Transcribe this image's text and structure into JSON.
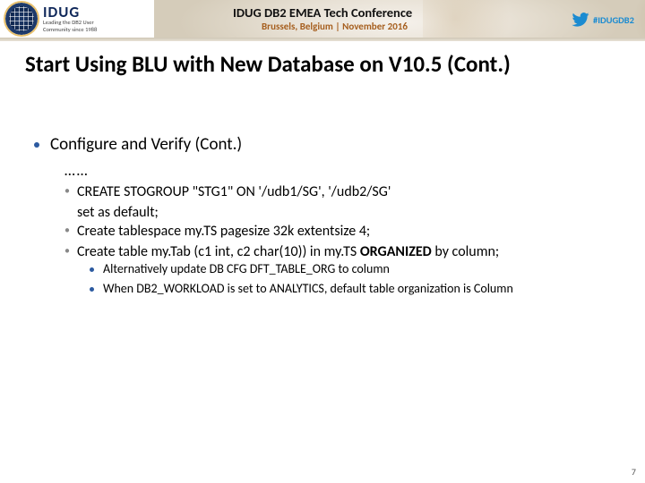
{
  "header": {
    "logo_title": "IDUG",
    "logo_tag1": "Leading the DB2 User",
    "logo_tag2": "Community since 1988",
    "conference_title": "IDUG DB2 EMEA Tech Conference",
    "conference_subtitle": "Brussels, Belgium  |  November 2016",
    "hashtag": "#IDUGDB2"
  },
  "slide": {
    "title": "Start Using BLU with New Database on V10.5 (Cont.)",
    "bullet_l1": "Configure and Verify (Cont.)",
    "ellipsis": "……",
    "l2": {
      "a_line1": "CREATE STOGROUP \"STG1\" ON '/udb1/SG', '/udb2/SG'",
      "a_line2": "set as default;",
      "b": "Create tablespace my.TS pagesize 32k extentsize 4;",
      "c_pre": "Create table my.Tab (c1 int, c2 char(10)) in my.TS ",
      "c_bold": "ORGANIZED",
      "c_post": " by column;"
    },
    "l3": {
      "a": "Alternatively update DB CFG DFT_TABLE_ORG to column",
      "b": "When DB2_WORKLOAD is set to ANALYTICS, default table organization is Column"
    },
    "page_number": "7"
  }
}
